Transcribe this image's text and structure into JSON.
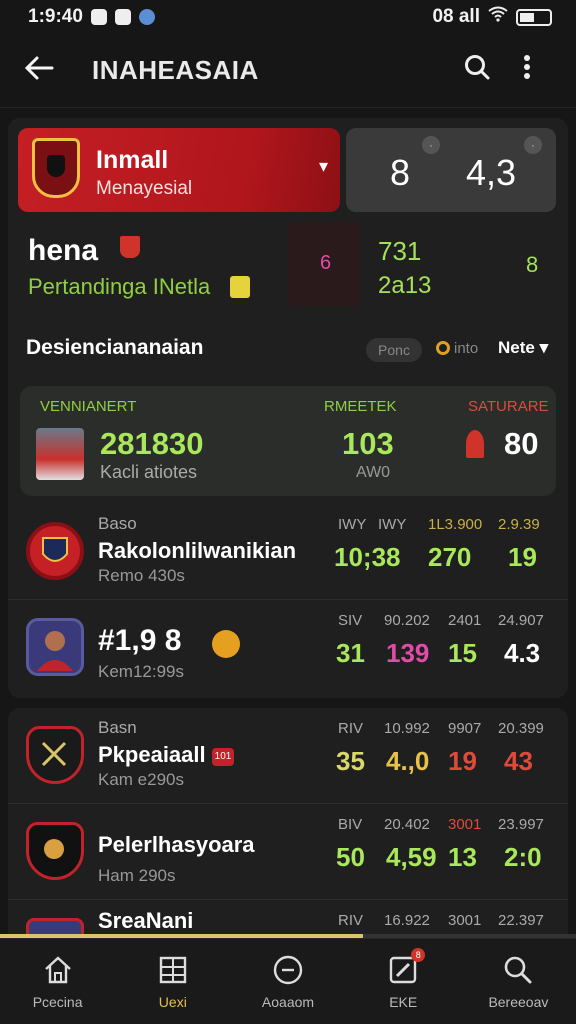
{
  "status": {
    "time": "1:9:40",
    "right": "08 all"
  },
  "appbar": {
    "title": "INAHEASAIA"
  },
  "hero": {
    "line1": "Inmall",
    "line2": "Menayesial",
    "score_a": "8",
    "score_b": "4,3"
  },
  "team": {
    "name": "hena",
    "subtitle": "Pertandinga INetla",
    "mini_val": "6",
    "mid_a": "731",
    "mid_b": "2a13",
    "mid_c": "8"
  },
  "section": {
    "title": "Desienciananaian",
    "pill": "Ponc",
    "info": "into",
    "more": "Nete"
  },
  "feature": {
    "h1": "VENNIANERT",
    "h2": "RMEETEK",
    "h3": "SATURARE",
    "v1": "281830",
    "s1": "Kacli atiotes",
    "v2": "103",
    "s2": "AW0",
    "v3": "80"
  },
  "rows": [
    {
      "label": "Baso",
      "name": "Rakolonlilwanikian",
      "time": "Remo 430s",
      "h": [
        "IWY",
        "IWY",
        "1L3.900",
        "2.9.39"
      ],
      "v": [
        "10;38",
        "270",
        "19"
      ]
    },
    {
      "name": "#1,9 8",
      "time": "Kem12:99s",
      "h": [
        "SIV",
        "90.202",
        "2401",
        "24.907"
      ],
      "v": [
        "31",
        "139",
        "15",
        "4.3"
      ]
    },
    {
      "label": "Basn",
      "name": "Pkpeaiaall",
      "chip": "101",
      "time": "Kam e290s",
      "h": [
        "RIV",
        "10.992",
        "9907",
        "20.399"
      ],
      "v": [
        "35",
        "4.,0",
        "19",
        "43"
      ]
    },
    {
      "name": "Pelerlhasyoara",
      "time": "Ham 290s",
      "h": [
        "BIV",
        "20.402",
        "3001",
        "23.997"
      ],
      "v": [
        "50",
        "4,59",
        "13",
        "2:0"
      ]
    },
    {
      "name": "SreaNani",
      "h": [
        "RIV",
        "16.922",
        "3001",
        "22.397"
      ]
    }
  ],
  "progress": 0.63,
  "tabs": [
    {
      "label": "Pcecina",
      "icon": "home-icon"
    },
    {
      "label": "Uexi",
      "icon": "grid-icon"
    },
    {
      "label": "Aoaaom",
      "icon": "circle-minus-icon"
    },
    {
      "label": "EKE",
      "icon": "edit-icon",
      "badge": "8"
    },
    {
      "label": "Bereeoav",
      "icon": "search-icon"
    }
  ]
}
